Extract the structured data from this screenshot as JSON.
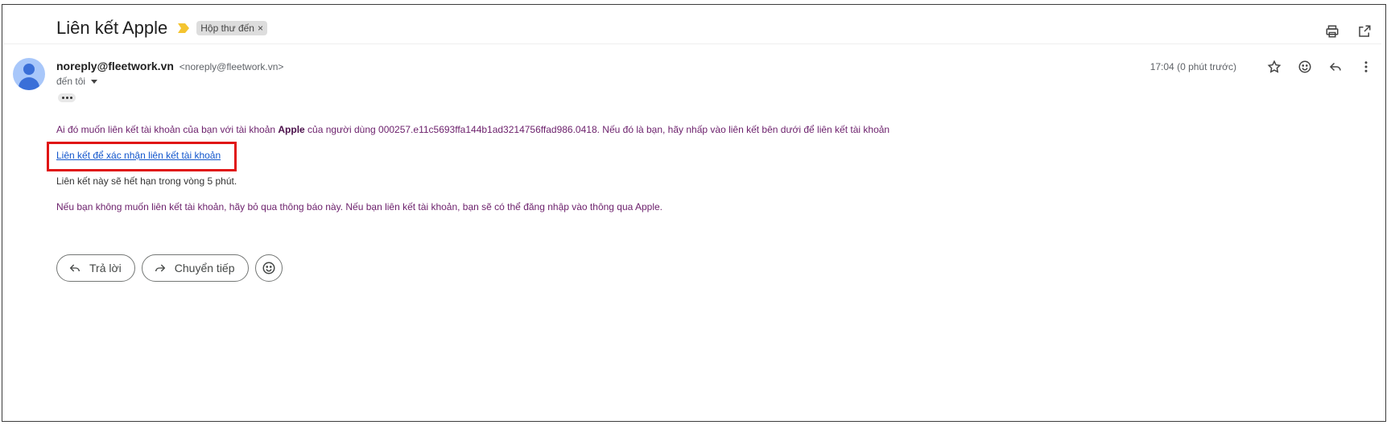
{
  "email": {
    "subject": "Liên kết Apple",
    "label": "Hộp thư đến",
    "label_remove": "×",
    "sender_name": "noreply@fleetwork.vn",
    "sender_email": "<noreply@fleetwork.vn>",
    "to_text": "đến tôi",
    "time": "17:04 (0 phút trước)"
  },
  "body": {
    "line1_prefix": "Ai đó muốn liên kết tài khoản của bạn với tài khoản ",
    "line1_bold": "Apple",
    "line1_suffix": " của người dùng 000257.e11c5693ffa144b1ad3214756ffad986.0418. Nếu đó là bạn, hãy nhấp vào liên kết bên dưới để liên kết tài khoản",
    "link_text": "Liên kết để xác nhận liên kết tài khoản",
    "line3": "Liên kết này sẽ hết hạn trong vòng 5 phút.",
    "line4": "Nếu bạn không muốn liên kết tài khoản, hãy bỏ qua thông báo này. Nếu bạn liên kết tài khoản, bạn sẽ có thể đăng nhập vào thông qua Apple."
  },
  "actions": {
    "reply_label": "Trả lời",
    "forward_label": "Chuyển tiếp"
  },
  "icons": {
    "print": "print-icon",
    "open_new_window": "open-in-new-icon",
    "star": "star-icon",
    "emoji": "emoji-icon",
    "reply": "reply-icon",
    "more": "more-vert-icon"
  },
  "colors": {
    "body_text": "#6b1f6b",
    "link": "#1155cc",
    "highlight_box": "#e01414",
    "important_marker": "#f4c430"
  }
}
